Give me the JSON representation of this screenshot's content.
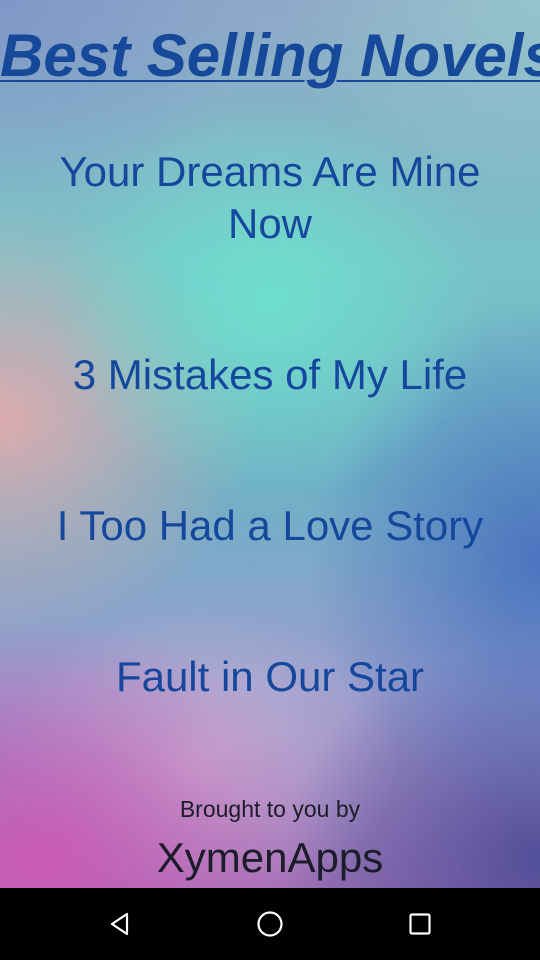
{
  "app": {
    "title": "Best Selling Novels",
    "title_color": "#17499a",
    "novel_color": "#15489c",
    "novels": [
      {
        "label": "Your Dreams Are Mine Now"
      },
      {
        "label": "3 Mistakes of My Life"
      },
      {
        "label": "I Too Had a Love Story"
      },
      {
        "label": "Fault in Our Star"
      }
    ],
    "footer": {
      "credit_line": "Brought to you by",
      "brand": "XymenApps",
      "text_color": "#1c1c2a"
    }
  },
  "navbar": {
    "background": "#000000",
    "icon_color": "#ffffff",
    "buttons": [
      {
        "name": "back",
        "icon": "triangle-back-icon"
      },
      {
        "name": "home",
        "icon": "circle-home-icon"
      },
      {
        "name": "recents",
        "icon": "square-recents-icon"
      }
    ]
  }
}
